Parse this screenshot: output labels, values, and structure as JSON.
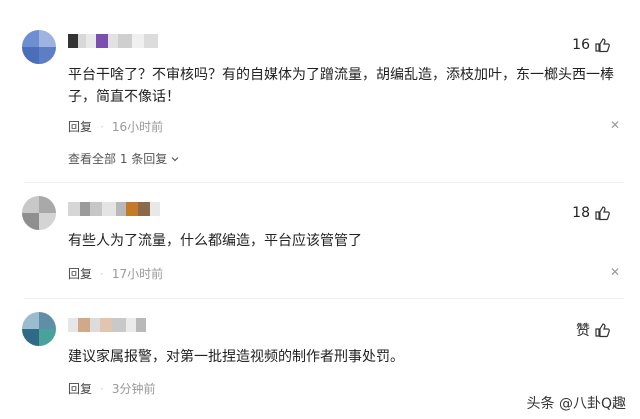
{
  "comments": [
    {
      "likes": "16",
      "text": "平台干啥了？不审核吗？有的自媒体为了蹭流量，胡编乱造，添枝加叶，东一榔头西一棒子，简直不像话！",
      "reply_label": "回复",
      "time": "16小时前",
      "more_replies": "查看全部 1 条回复",
      "avatar_colors": [
        "#6d8fd1",
        "#9fb3e0",
        "#4a6fb8",
        "#c9d5ef"
      ]
    },
    {
      "likes": "18",
      "text": "有些人为了流量，什么都编造，平台应该管管了",
      "reply_label": "回复",
      "time": "17小时前",
      "avatar_colors": [
        "#c8c8c8",
        "#a9a9a9",
        "#e0e0e0",
        "#8f8f8f"
      ]
    },
    {
      "likes": "赞",
      "text": "建议家属报警，对第一批捏造视频的制作者刑事处罚。",
      "reply_label": "回复",
      "time": "3分钟前",
      "avatar_colors": [
        "#5f8fa8",
        "#9bbccc",
        "#2f6b86",
        "#d2e3ea"
      ]
    }
  ],
  "icons": {
    "like": "thumbs-up-icon",
    "close": "close-icon",
    "chevron": "chevron-down-icon"
  },
  "watermark": "头条 @八卦Q趣"
}
